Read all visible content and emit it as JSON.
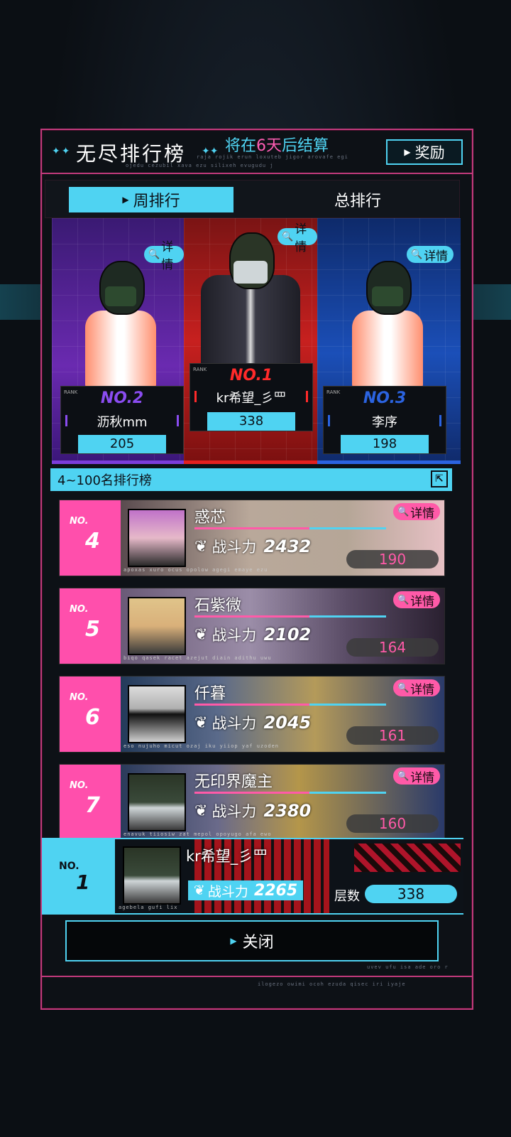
{
  "header": {
    "title": "无尽排行榜",
    "settle_prefix": "将在",
    "settle_days": "6天",
    "settle_suffix": "后结算",
    "reward_label": "奖励",
    "deco_line1": "raja rojik erun loxuteb jigor arovafe egi",
    "deco_line2": "ojedu cezubil xava ezu silixeh evugudu j"
  },
  "tabs": {
    "weekly": "周排行",
    "total": "总排行",
    "active": "weekly"
  },
  "detail_label": "详情",
  "rank_label": "RANK",
  "podium": [
    {
      "rank": "NO.2",
      "name": "沥秋mm",
      "value": "205",
      "color": "#7b3cd9"
    },
    {
      "rank": "NO.1",
      "name": "kr希望_彡罒",
      "value": "338",
      "color": "#e3201f"
    },
    {
      "rank": "NO.3",
      "name": "李序",
      "value": "198",
      "color": "#2b63e0"
    }
  ],
  "list_header": "4~100名排行榜",
  "power_label": "战斗力",
  "no_label": "NO.",
  "rows": [
    {
      "no": "4",
      "name": "惑芯",
      "power": "2432",
      "floor": "190",
      "deco": "apoxas xuro ocus opolow agegi emaye ezu"
    },
    {
      "no": "5",
      "name": "石紫微",
      "power": "2102",
      "floor": "164",
      "deco": "biqo qasek racet azejut diain adithu uwu"
    },
    {
      "no": "6",
      "name": "仟暮",
      "power": "2045",
      "floor": "161",
      "deco": "eso nujuho micut ozaj iku yiiop yaf uzoden"
    },
    {
      "no": "7",
      "name": "无印界魔主",
      "power": "2380",
      "floor": "160",
      "deco": "enavuk tiiosiw zat mepol opoyugo afa ewo"
    }
  ],
  "me": {
    "no": "1",
    "name": "kr希望_彡罒",
    "power": "2265",
    "floor_label": "层数",
    "floor": "338",
    "deco": "agebela gufi lix"
  },
  "close_label": "关闭",
  "footer_deco1": "uvev ufu isa ade oro r",
  "footer_deco2": "ilogezo owimi ocoh ezuda qisec iri iyaje",
  "colors": {
    "accent": "#4fd3f2",
    "pink": "#ff4fac",
    "frame": "#c23a7c"
  }
}
